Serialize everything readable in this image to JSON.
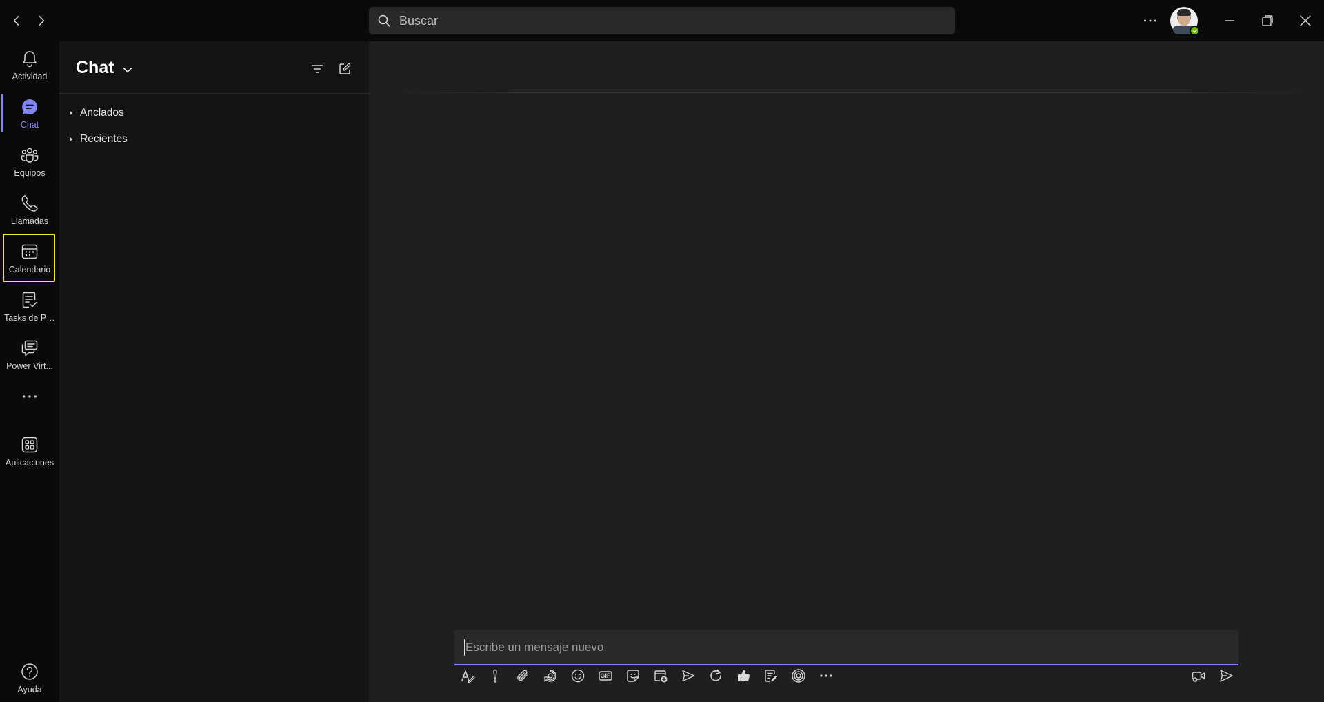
{
  "titlebar": {
    "search_placeholder": "Buscar"
  },
  "appbar": {
    "items": [
      {
        "label": "Actividad",
        "icon": "bell-icon"
      },
      {
        "label": "Chat",
        "icon": "chat-icon",
        "active": true
      },
      {
        "label": "Equipos",
        "icon": "teams-icon"
      },
      {
        "label": "Llamadas",
        "icon": "phone-icon"
      },
      {
        "label": "Calendario",
        "icon": "calendar-icon",
        "highlighted": true
      },
      {
        "label": "Tasks de Pl...",
        "icon": "tasks-icon"
      },
      {
        "label": "Power Virt...",
        "icon": "power-virtual-agents-icon"
      },
      {
        "label": "Aplicaciones",
        "icon": "apps-icon"
      },
      {
        "label": "Ayuda",
        "icon": "help-icon"
      }
    ],
    "more_glyph": "···"
  },
  "chatpane": {
    "title": "Chat",
    "sections": [
      {
        "name": "Anclados"
      },
      {
        "name": "Recientes"
      }
    ]
  },
  "composer": {
    "placeholder": "Escribe un mensaje nuevo"
  },
  "toolbar": {
    "tools": [
      "format-icon",
      "important-icon",
      "attach-icon",
      "loop-icon",
      "emoji-icon",
      "gif-icon",
      "sticker-icon",
      "schedule-meeting-icon",
      "stream-icon",
      "praise-icon",
      "approvals-icon",
      "forms-icon",
      "viva-icon",
      "more-icon"
    ],
    "gif_label": "GIF"
  },
  "colors": {
    "accent": "#7f85f5",
    "highlight": "#f2e928",
    "presence": "#6bb700"
  }
}
